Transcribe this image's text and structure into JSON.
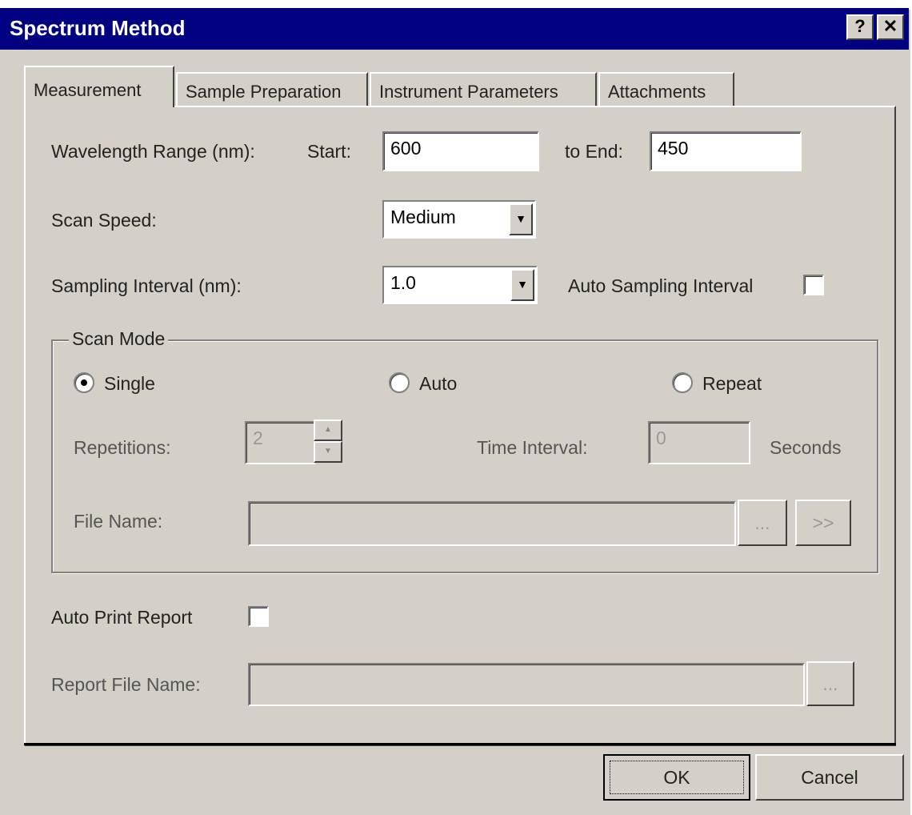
{
  "window": {
    "title": "Spectrum Method",
    "help_label": "?",
    "close_label": "✕"
  },
  "tabs": [
    {
      "label": "Measurement",
      "active": true
    },
    {
      "label": "Sample Preparation",
      "active": false
    },
    {
      "label": "Instrument Parameters",
      "active": false
    },
    {
      "label": "Attachments",
      "active": false
    }
  ],
  "wavelength": {
    "label": "Wavelength Range (nm):",
    "start_label": "Start:",
    "start_value": "600",
    "end_label": "to End:",
    "end_value": "450"
  },
  "scan_speed": {
    "label": "Scan Speed:",
    "value": "Medium"
  },
  "sampling": {
    "label": "Sampling Interval (nm):",
    "value": "1.0",
    "auto_label": "Auto Sampling Interval",
    "auto_checked": false
  },
  "scan_mode": {
    "title": "Scan Mode",
    "options": [
      {
        "label": "Single",
        "selected": true
      },
      {
        "label": "Auto",
        "selected": false
      },
      {
        "label": "Repeat",
        "selected": false
      }
    ],
    "repetitions_label": "Repetitions:",
    "repetitions_value": "2",
    "time_interval_label": "Time Interval:",
    "time_interval_value": "0",
    "seconds_label": "Seconds",
    "file_name_label": "File Name:",
    "file_name_value": "",
    "browse_label": "...",
    "next_label": ">>"
  },
  "auto_print": {
    "label": "Auto Print Report",
    "checked": false
  },
  "report_file": {
    "label": "Report File Name:",
    "value": "",
    "browse_label": "..."
  },
  "footer": {
    "ok_label": "OK",
    "cancel_label": "Cancel"
  },
  "colors": {
    "titlebar": "#000080",
    "face": "#d4d0c8"
  }
}
